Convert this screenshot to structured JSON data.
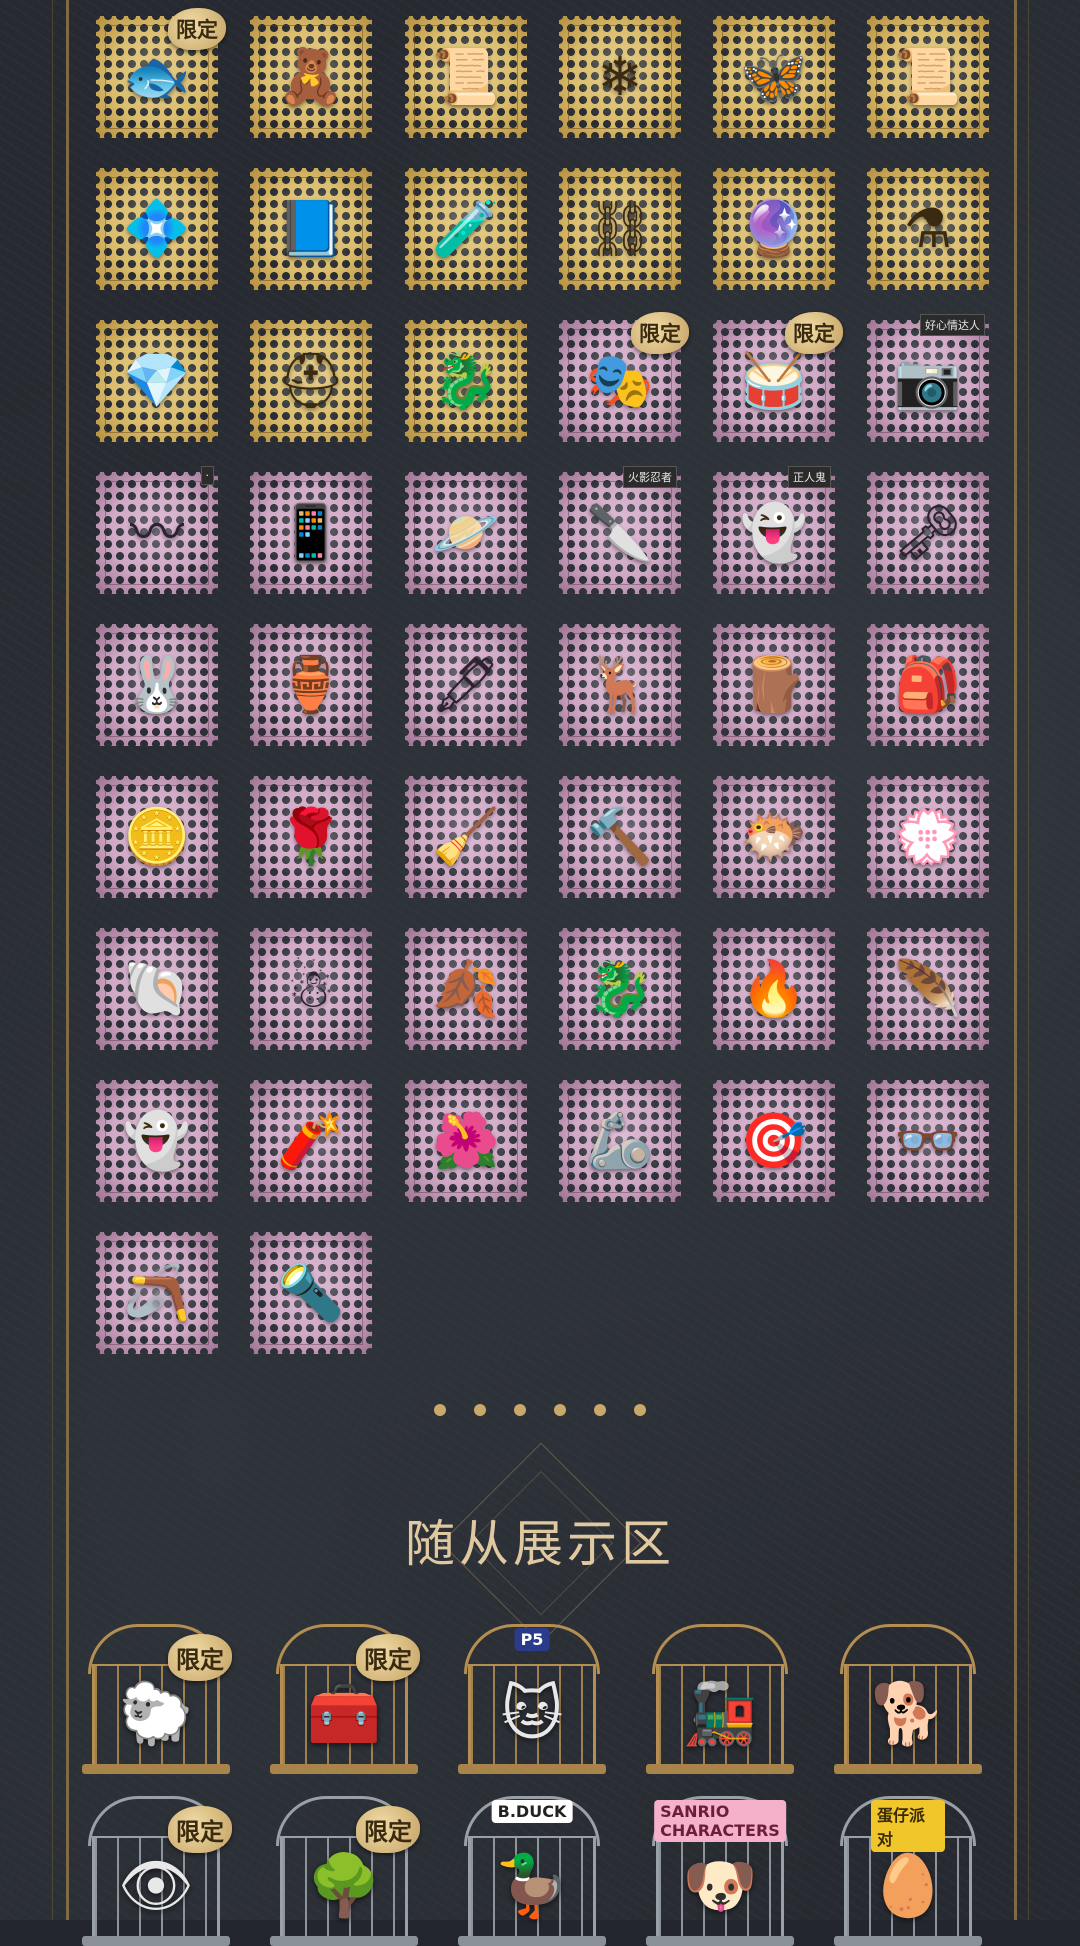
{
  "stamps": {
    "limited_tag": "限定",
    "rows": [
      [
        {
          "style": "gold",
          "icon": "🐟",
          "tag": true
        },
        {
          "style": "gold",
          "icon": "🧸"
        },
        {
          "style": "gold",
          "icon": "📜"
        },
        {
          "style": "gold",
          "icon": "❄"
        },
        {
          "style": "gold",
          "icon": "🦋"
        },
        {
          "style": "gold",
          "icon": "📜"
        }
      ],
      [
        {
          "style": "gold",
          "icon": "💠"
        },
        {
          "style": "gold",
          "icon": "📘"
        },
        {
          "style": "gold",
          "icon": "🧪"
        },
        {
          "style": "gold",
          "icon": "⛓"
        },
        {
          "style": "gold",
          "icon": "🔮"
        },
        {
          "style": "gold",
          "icon": "⚗"
        }
      ],
      [
        {
          "style": "gold",
          "icon": "💎"
        },
        {
          "style": "gold",
          "icon": "⛑"
        },
        {
          "style": "gold",
          "icon": "🐉"
        },
        {
          "style": "pink",
          "icon": "🎭",
          "tag": true
        },
        {
          "style": "pink",
          "icon": "🥁",
          "tag": true
        },
        {
          "style": "pink",
          "icon": "📷",
          "ribbon": "好心情达人"
        }
      ],
      [
        {
          "style": "pink",
          "icon": "〰",
          "ribbon": "·"
        },
        {
          "style": "pink",
          "icon": "📱"
        },
        {
          "style": "pink",
          "icon": "🪐"
        },
        {
          "style": "pink",
          "icon": "🔪",
          "ribbon": "火影忍者"
        },
        {
          "style": "pink",
          "icon": "👻",
          "ribbon": "正人鬼"
        },
        {
          "style": "pink",
          "icon": "🗝"
        }
      ],
      [
        {
          "style": "pink",
          "icon": "🐰"
        },
        {
          "style": "pink",
          "icon": "🏺"
        },
        {
          "style": "pink",
          "icon": "🖋"
        },
        {
          "style": "pink",
          "icon": "🦌"
        },
        {
          "style": "pink",
          "icon": "🪵"
        },
        {
          "style": "pink",
          "icon": "🎒"
        }
      ],
      [
        {
          "style": "pink",
          "icon": "🪙"
        },
        {
          "style": "pink",
          "icon": "🌹"
        },
        {
          "style": "pink",
          "icon": "🧹"
        },
        {
          "style": "pink",
          "icon": "🔨"
        },
        {
          "style": "pink",
          "icon": "🐡"
        },
        {
          "style": "pink",
          "icon": "💮"
        }
      ],
      [
        {
          "style": "pink",
          "icon": "🐚"
        },
        {
          "style": "pink",
          "icon": "☃"
        },
        {
          "style": "pink",
          "icon": "🍂"
        },
        {
          "style": "pink",
          "icon": "🐉"
        },
        {
          "style": "pink",
          "icon": "🔥"
        },
        {
          "style": "pink",
          "icon": "🪶"
        }
      ],
      [
        {
          "style": "pink",
          "icon": "👻"
        },
        {
          "style": "pink",
          "icon": "🧨"
        },
        {
          "style": "pink",
          "icon": "🌺"
        },
        {
          "style": "pink",
          "icon": "🦾"
        },
        {
          "style": "pink",
          "icon": "🎯"
        },
        {
          "style": "pink",
          "icon": "👓"
        }
      ],
      [
        {
          "style": "pink",
          "icon": "🪃"
        },
        {
          "style": "pink",
          "icon": "🔦"
        }
      ]
    ]
  },
  "pager": {
    "count": 6
  },
  "companion_section": {
    "title": "随从展示区"
  },
  "cages": {
    "limited_tag": "限定",
    "rows": [
      [
        {
          "metal": "gold",
          "icon": "🐑",
          "tag": true
        },
        {
          "metal": "gold",
          "icon": "🧰",
          "tag": true
        },
        {
          "metal": "gold",
          "icon": "🐱",
          "logo": "P5",
          "logo_style": "blue"
        },
        {
          "metal": "gold",
          "icon": "🚂"
        },
        {
          "metal": "gold",
          "icon": "🐕"
        }
      ],
      [
        {
          "metal": "silver",
          "icon": "👁",
          "tag": true
        },
        {
          "metal": "silver",
          "icon": "🌳",
          "tag": true
        },
        {
          "metal": "silver",
          "icon": "🦆",
          "logo": "B.DUCK",
          "logo_style": "ducky"
        },
        {
          "metal": "silver",
          "icon": "🐶",
          "logo": "SANRIO CHARACTERS",
          "logo_style": "pink"
        },
        {
          "metal": "silver",
          "icon": "🥚",
          "logo": "蛋仔派对",
          "logo_style": "yellow"
        }
      ]
    ]
  }
}
